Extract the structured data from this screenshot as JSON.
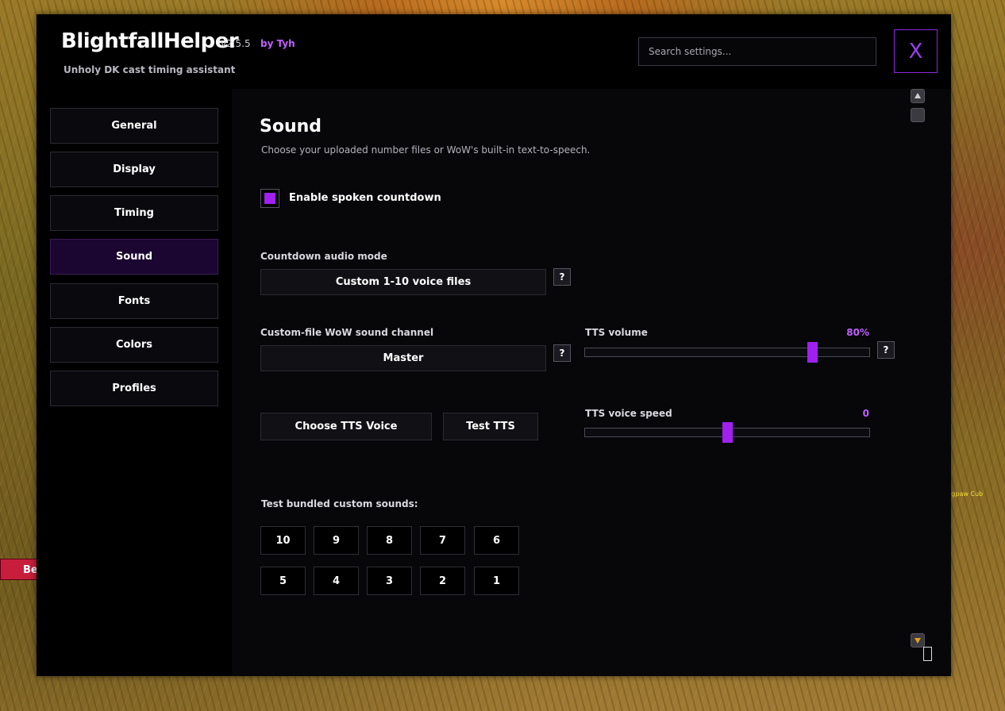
{
  "window": {
    "title": "BlightfallHelper",
    "version": "v2.5.5",
    "author": "by Tyh",
    "subtitle": "Unholy DK cast timing assistant",
    "close_label": "X"
  },
  "search": {
    "placeholder": "Search settings..."
  },
  "sidebar": {
    "items": [
      {
        "label": "General"
      },
      {
        "label": "Display"
      },
      {
        "label": "Timing"
      },
      {
        "label": "Sound"
      },
      {
        "label": "Fonts"
      },
      {
        "label": "Colors"
      },
      {
        "label": "Profiles"
      }
    ],
    "active": "Sound"
  },
  "section": {
    "title": "Sound",
    "description": "Choose your uploaded number files or WoW's built-in text-to-speech."
  },
  "enable_countdown": {
    "label": "Enable spoken countdown",
    "checked": true
  },
  "audio_mode": {
    "label": "Countdown audio mode",
    "value": "Custom 1-10 voice files",
    "help": "?"
  },
  "sound_channel": {
    "label": "Custom-file WoW sound channel",
    "value": "Master",
    "help": "?"
  },
  "tts_volume": {
    "label": "TTS volume",
    "display": "80%",
    "value": 80,
    "min": 0,
    "max": 100,
    "help": "?"
  },
  "tts_speed": {
    "label": "TTS voice speed",
    "display": "0",
    "value": 0,
    "min": -10,
    "max": 10
  },
  "buttons": {
    "choose_tts_voice": "Choose TTS Voice",
    "test_tts": "Test TTS"
  },
  "test_sounds": {
    "label": "Test bundled custom sounds:",
    "row1": [
      "10",
      "9",
      "8",
      "7",
      "6"
    ],
    "row2": [
      "5",
      "4",
      "3",
      "2",
      "1"
    ]
  },
  "world": {
    "badge": "Be",
    "nameplate": "Longpaw Cub"
  },
  "colors": {
    "accent": "#a020f0",
    "accent_text": "#c060ff",
    "active_nav": "#1a0630"
  }
}
